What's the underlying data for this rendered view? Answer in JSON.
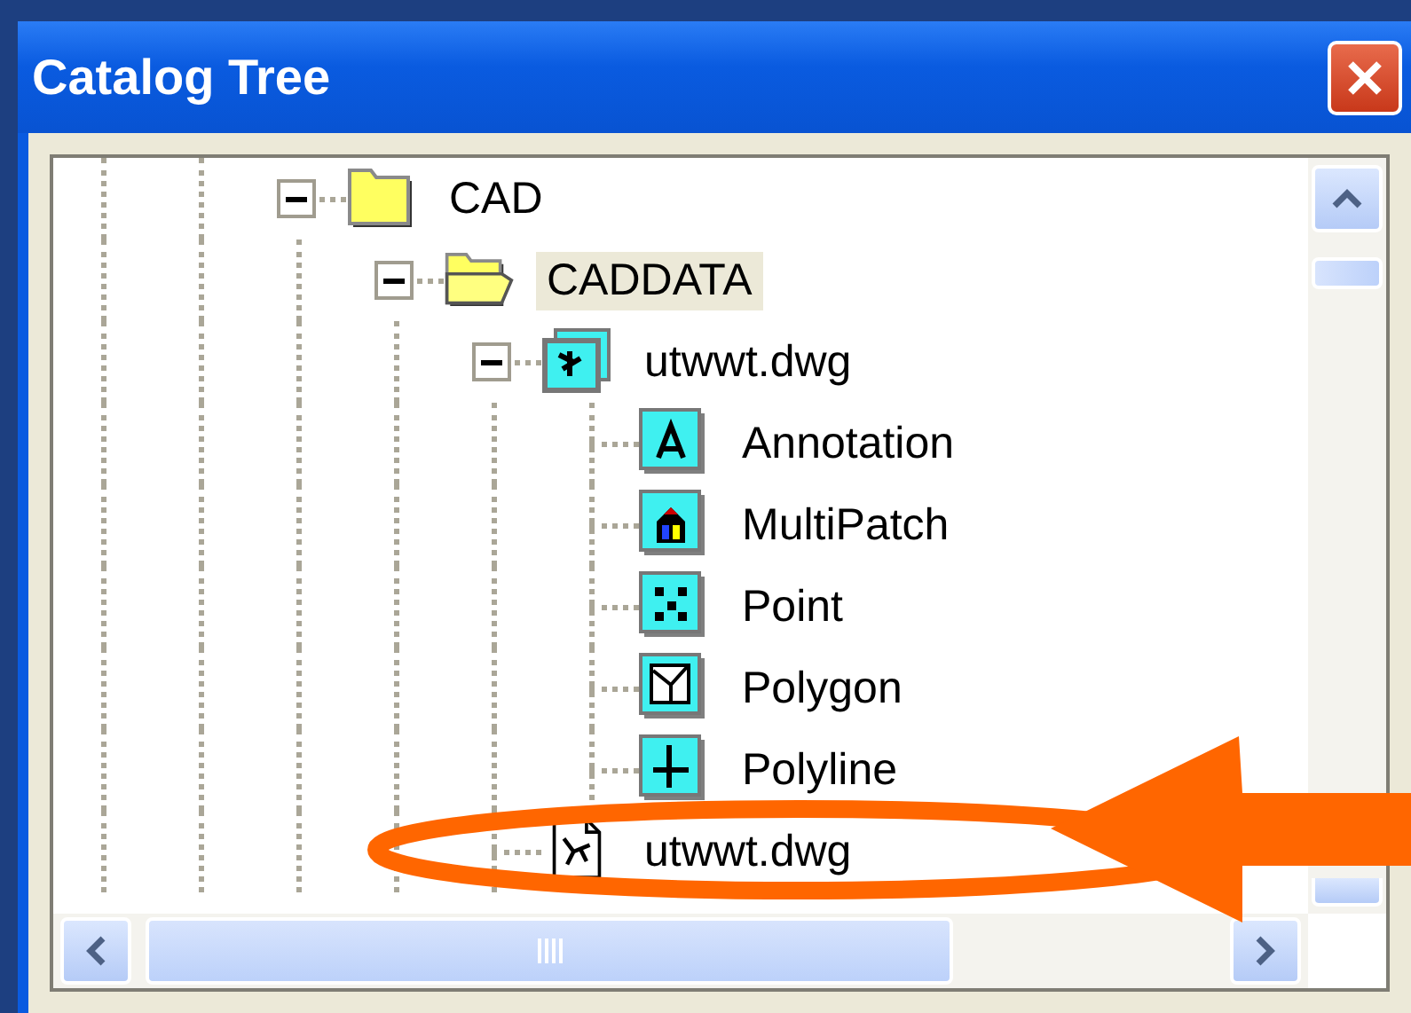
{
  "window": {
    "title": "Catalog Tree"
  },
  "tree": [
    {
      "label": "CAD",
      "kind": "folder",
      "selected": false,
      "expanded": true,
      "children": [
        {
          "label": "CADDATA",
          "kind": "open-folder",
          "selected": true,
          "expanded": true,
          "children": [
            {
              "label": "utwwt.dwg",
              "kind": "cad-dataset",
              "selected": false,
              "expanded": true,
              "children": [
                {
                  "label": "Annotation",
                  "kind": "annotation",
                  "selected": false
                },
                {
                  "label": "MultiPatch",
                  "kind": "multipatch",
                  "selected": false
                },
                {
                  "label": "Point",
                  "kind": "point",
                  "selected": false
                },
                {
                  "label": "Polygon",
                  "kind": "polygon",
                  "selected": false
                },
                {
                  "label": "Polyline",
                  "kind": "polyline",
                  "selected": false
                }
              ]
            },
            {
              "label": "utwwt.dwg",
              "kind": "drawing",
              "selected": false
            }
          ]
        }
      ]
    }
  ]
}
